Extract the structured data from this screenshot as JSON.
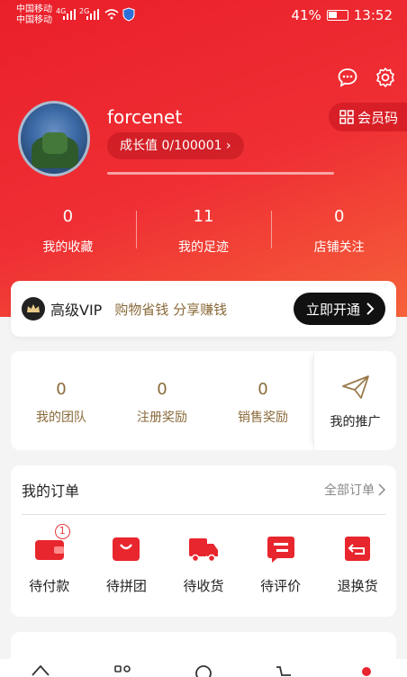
{
  "status": {
    "carrier1": "中国移动",
    "carrier2": "中国移动",
    "net1": "4G",
    "net2": "2G",
    "battery": "41%",
    "time": "13:52"
  },
  "header": {
    "message_icon": "chat-bubble-icon",
    "settings_icon": "gear-icon",
    "member_code": "会员码"
  },
  "profile": {
    "username": "forcenet",
    "growth_label": "成长值 0/100001",
    "growth_progress": 0
  },
  "stats": [
    {
      "value": "0",
      "label": "我的收藏"
    },
    {
      "value": "11",
      "label": "我的足迹"
    },
    {
      "value": "0",
      "label": "店铺关注"
    }
  ],
  "vip": {
    "title": "高级VIP",
    "slogan": "购物省钱 分享赚钱",
    "button": "立即开通"
  },
  "promo": {
    "items": [
      {
        "value": "0",
        "label": "我的团队"
      },
      {
        "value": "0",
        "label": "注册奖励"
      },
      {
        "value": "0",
        "label": "销售奖励"
      }
    ],
    "side_label": "我的推广"
  },
  "orders": {
    "title": "我的订单",
    "all_label": "全部订单",
    "items": [
      {
        "label": "待付款",
        "icon": "wallet-icon",
        "badge": "1"
      },
      {
        "label": "待拼团",
        "icon": "shopping-bag-icon"
      },
      {
        "label": "待收货",
        "icon": "truck-icon"
      },
      {
        "label": "待评价",
        "icon": "review-icon"
      },
      {
        "label": "退换货",
        "icon": "return-icon"
      }
    ]
  },
  "colors": {
    "brand_red": "#ea1f2a",
    "gold": "#8a6a3a",
    "icon_red": "#e8262d"
  }
}
